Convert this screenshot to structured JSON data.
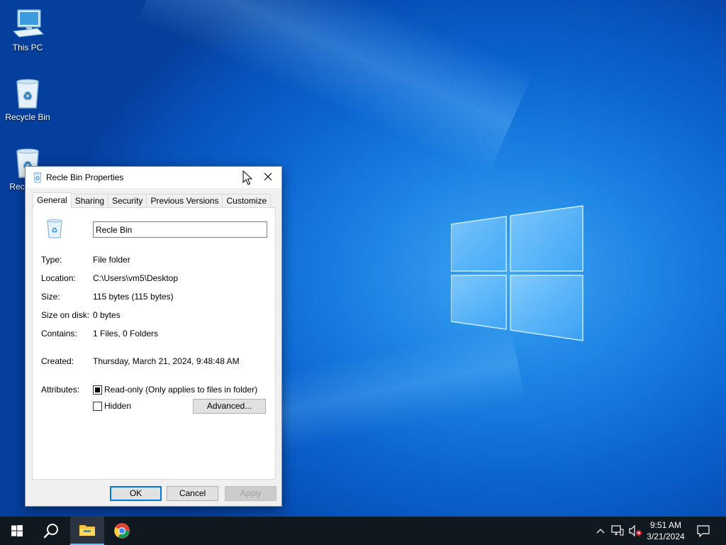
{
  "desktop": {
    "icons": [
      {
        "label": "This PC"
      },
      {
        "label": "Recycle Bin"
      },
      {
        "label": "Recle Bin"
      }
    ]
  },
  "dialog": {
    "title": "Recle Bin Properties",
    "tabs": [
      "General",
      "Sharing",
      "Security",
      "Previous Versions",
      "Customize"
    ],
    "active_tab": "General",
    "name_value": "Recle Bin",
    "fields": [
      {
        "label": "Type:",
        "value": "File folder"
      },
      {
        "label": "Location:",
        "value": "C:\\Users\\vm5\\Desktop"
      },
      {
        "label": "Size:",
        "value": "115 bytes (115 bytes)"
      },
      {
        "label": "Size on disk:",
        "value": "0 bytes"
      },
      {
        "label": "Contains:",
        "value": "1 Files, 0 Folders"
      }
    ],
    "created": {
      "label": "Created:",
      "value": "Thursday, March 21, 2024, 9:48:48 AM"
    },
    "attributes": {
      "label": "Attributes:",
      "readonly_label": "Read-only (Only applies to files in folder)",
      "readonly_state": "indeterminate",
      "hidden_label": "Hidden",
      "hidden_checked": false,
      "advanced_label": "Advanced..."
    },
    "buttons": {
      "ok": "OK",
      "cancel": "Cancel",
      "apply": "Apply"
    }
  },
  "taskbar": {
    "time": "9:51 AM",
    "date": "3/21/2024",
    "items": [
      "start-icon",
      "search-icon",
      "file-explorer-icon",
      "chrome-icon"
    ],
    "tray": [
      "chevron-up-icon",
      "network-icon",
      "volume-muted-icon",
      "notification-icon"
    ]
  },
  "colors": {
    "accent": "#0078d7",
    "taskbar": "#101820"
  }
}
